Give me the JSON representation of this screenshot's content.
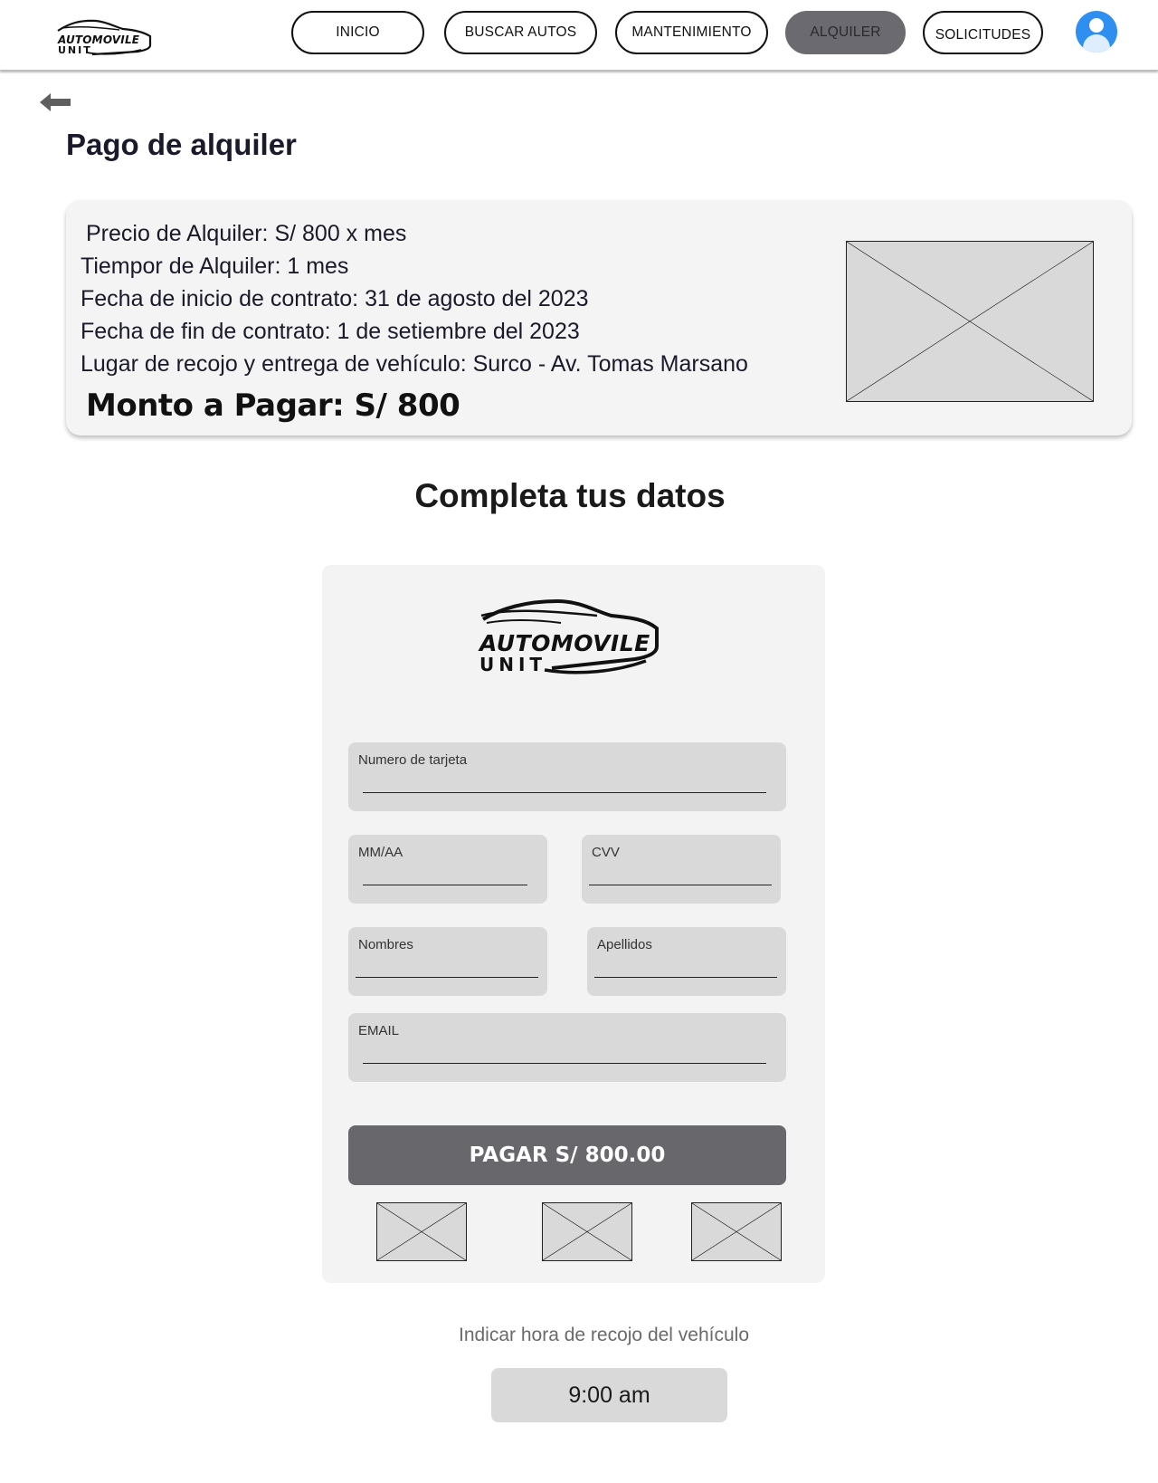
{
  "header": {
    "logo": {
      "line1": "AUTOMOVILE",
      "line2": "UNIT"
    },
    "nav": [
      {
        "label": "INICIO"
      },
      {
        "label": "BUSCAR AUTOS"
      },
      {
        "label": "MANTENIMIENTO"
      },
      {
        "label": "ALQUILER",
        "active": true
      },
      {
        "label": "SOLICITUDES"
      }
    ],
    "avatar_icon": "user-avatar-icon"
  },
  "page": {
    "back_icon": "arrow-left-icon",
    "title": "Pago de alquiler"
  },
  "summary": {
    "lines": [
      "Precio de Alquiler:  S/ 800 x mes",
      "Tiempor de Alquiler: 1 mes",
      "Fecha de inicio de contrato: 31 de agosto del 2023",
      "Fecha de fin de contrato: 1 de setiembre del 2023",
      "Lugar de recojo y entrega de vehículo: Surco - Av. Tomas Marsano"
    ],
    "amount": "Monto a Pagar:  S/ 800",
    "image_icon": "image-placeholder-icon"
  },
  "form": {
    "section_title": "Completa tus datos",
    "logo": {
      "line1": "AUTOMOVILE",
      "line2": "UNIT"
    },
    "fields": {
      "card_number": {
        "label": "Numero de tarjeta",
        "value": ""
      },
      "expiry": {
        "label": "MM/AA",
        "value": ""
      },
      "cvv": {
        "label": "CVV",
        "value": ""
      },
      "first_name": {
        "label": "Nombres",
        "value": ""
      },
      "last_name": {
        "label": "Apellidos",
        "value": ""
      },
      "email": {
        "label": "EMAIL",
        "value": ""
      }
    },
    "pay_button": "PAGAR S/ 800.00",
    "payment_icons": [
      "payment-method-icon",
      "payment-method-icon",
      "payment-method-icon"
    ]
  },
  "pickup": {
    "label": "Indicar hora de recojo del vehículo",
    "time": "9:00 am"
  },
  "colors": {
    "active_nav": "#6b6a70",
    "pay_button": "#68676c",
    "avatar": "#2f8ff0",
    "card_bg": "#f4f4f4",
    "field_bg": "#d9d9d9"
  }
}
